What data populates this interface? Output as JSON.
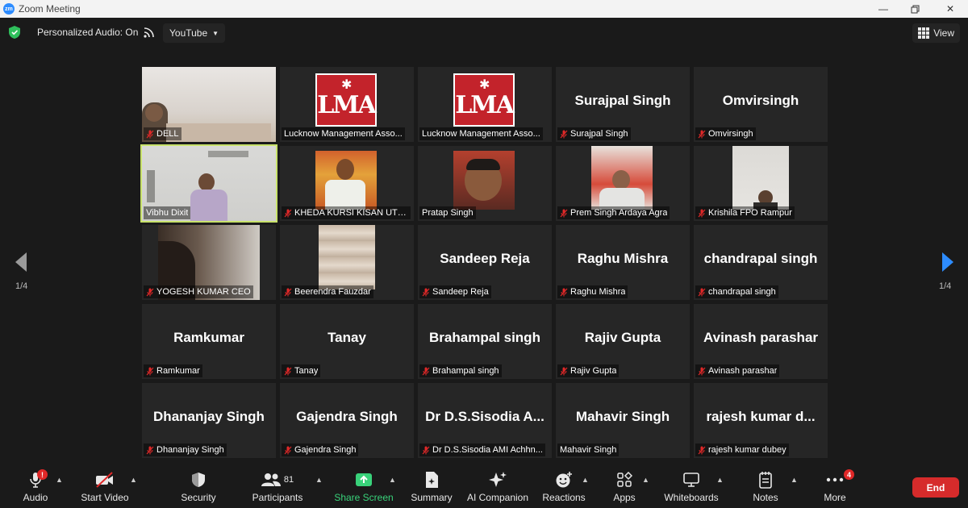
{
  "window": {
    "title": "Zoom Meeting",
    "logo_text": "zm"
  },
  "topbar": {
    "audio_status": "Personalized Audio: On",
    "stream_target": "YouTube",
    "view_label": "View"
  },
  "grid": {
    "page_indicator": "1/4",
    "tiles": [
      {
        "display": "",
        "label": "DELL",
        "muted": true
      },
      {
        "display": "",
        "label": "Lucknow Management Asso...",
        "muted": false
      },
      {
        "display": "",
        "label": "Lucknow Management Asso...",
        "muted": false
      },
      {
        "display": "Surajpal Singh",
        "label": "Surajpal Singh",
        "muted": true
      },
      {
        "display": "Omvirsingh",
        "label": "Omvirsingh",
        "muted": true
      },
      {
        "display": "",
        "label": "Vibhu Dixit",
        "muted": false
      },
      {
        "display": "",
        "label": "KHEDA KURSI KISAN UTP...",
        "muted": true
      },
      {
        "display": "",
        "label": "Pratap Singh",
        "muted": false
      },
      {
        "display": "",
        "label": "Prem Singh Ardaya Agra",
        "muted": true
      },
      {
        "display": "",
        "label": "Krishila FPO Rampur",
        "muted": true
      },
      {
        "display": "",
        "label": "YOGESH KUMAR CEO",
        "muted": true
      },
      {
        "display": "",
        "label": "Beerendra Fauzdar",
        "muted": true
      },
      {
        "display": "Sandeep Reja",
        "label": "Sandeep Reja",
        "muted": true
      },
      {
        "display": "Raghu Mishra",
        "label": "Raghu Mishra",
        "muted": true
      },
      {
        "display": "chandrapal singh",
        "label": "chandrapal singh",
        "muted": true
      },
      {
        "display": "Ramkumar",
        "label": "Ramkumar",
        "muted": true
      },
      {
        "display": "Tanay",
        "label": "Tanay",
        "muted": true
      },
      {
        "display": "Brahampal singh",
        "label": "Brahampal singh",
        "muted": true
      },
      {
        "display": "Rajiv Gupta",
        "label": "Rajiv Gupta",
        "muted": true
      },
      {
        "display": "Avinash parashar",
        "label": "Avinash parashar",
        "muted": true
      },
      {
        "display": "Dhananjay Singh",
        "label": "Dhananjay Singh",
        "muted": true
      },
      {
        "display": "Gajendra Singh",
        "label": "Gajendra Singh",
        "muted": true
      },
      {
        "display": "Dr D.S.Sisodia A...",
        "label": "Dr D.S.Sisodia AMI Achhn...",
        "muted": true
      },
      {
        "display": "Mahavir Singh",
        "label": "Mahavir Singh",
        "muted": false
      },
      {
        "display": "rajesh kumar d...",
        "label": "rajesh kumar dubey",
        "muted": true
      }
    ],
    "lma_logo_text": "LMA"
  },
  "toolbar": {
    "audio": "Audio",
    "start_video": "Start Video",
    "security": "Security",
    "participants": "Participants",
    "participant_count": "81",
    "share_screen": "Share Screen",
    "summary": "Summary",
    "ai_companion": "AI Companion",
    "reactions": "Reactions",
    "apps": "Apps",
    "whiteboards": "Whiteboards",
    "notes": "Notes",
    "more": "More",
    "more_badge": "4",
    "audio_badge": "!",
    "end": "End"
  },
  "colors": {
    "active_speaker_border": "#c8e26b",
    "share_green": "#39d27a",
    "end_red": "#d62b2b",
    "mute_red": "#e02828"
  }
}
